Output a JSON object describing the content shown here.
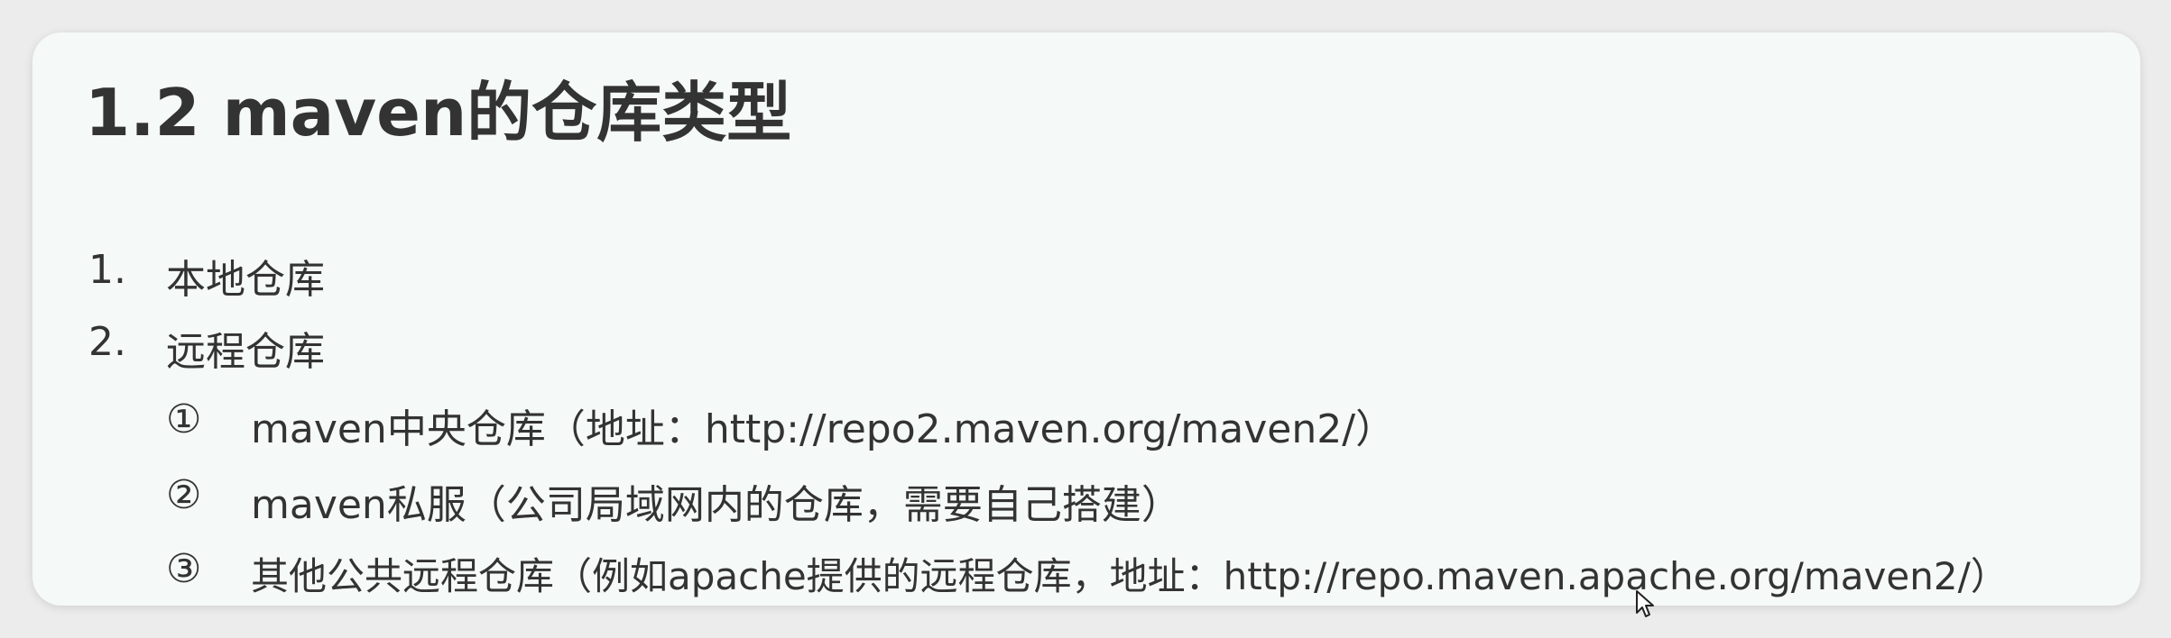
{
  "slide": {
    "title": "1.2 maven的仓库类型",
    "list": [
      {
        "marker": "1.",
        "text": "本地仓库"
      },
      {
        "marker": "2.",
        "text": "远程仓库"
      }
    ],
    "sublist": [
      {
        "marker": "①",
        "text": "maven中央仓库（地址：http://repo2.maven.org/maven2/）"
      },
      {
        "marker": "②",
        "text": "maven私服（公司局域网内的仓库，需要自己搭建）"
      },
      {
        "marker": "③",
        "text": "其他公共远程仓库（例如apache提供的远程仓库，地址：http://repo.maven.apache.org/maven2/）"
      }
    ]
  },
  "icons": {
    "cursor": "mouse-pointer-icon"
  }
}
